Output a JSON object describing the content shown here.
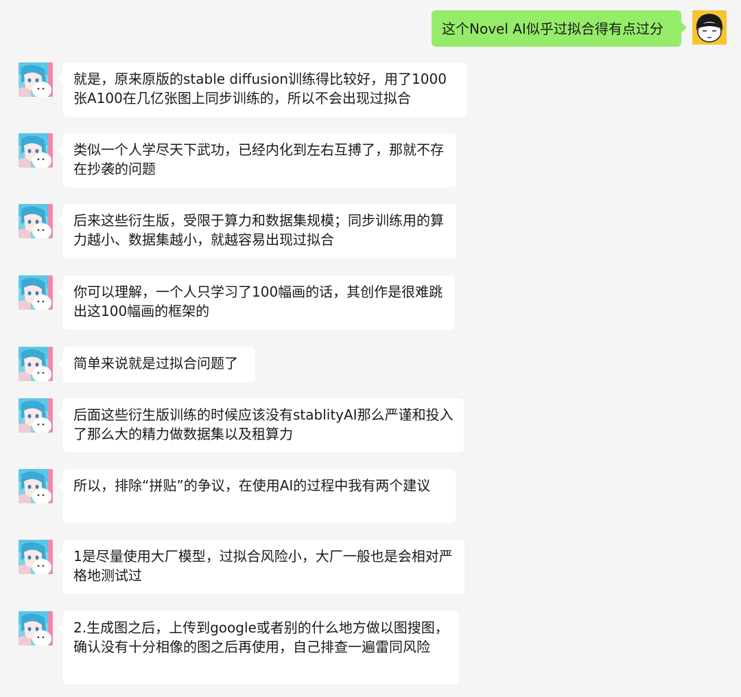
{
  "self_message": {
    "text": "这个Novel AI似乎过拟合得有点过分",
    "avatar": "cartoon-boy-avatar-icon"
  },
  "other_avatar": "anime-girl-avatar-icon",
  "messages": [
    {
      "text": "就是，原来原版的stable diffusion训练得比较好，用了1000张A100在几亿张图上同步训练的，所以不会出现过拟合"
    },
    {
      "text": "类似一个人学尽天下武功，已经内化到左右互搏了，那就不存在抄袭的问题"
    },
    {
      "text": "后来这些衍生版，受限于算力和数据集规模；同步训练用的算力越小、数据集越小，就越容易出现过拟合"
    },
    {
      "text": "你可以理解，一个人只学习了100幅画的话，其创作是很难跳出这100幅画的框架的"
    },
    {
      "text": "简单来说就是过拟合问题了"
    },
    {
      "text": "后面这些衍生版训练的时候应该没有stablityAI那么严谨和投入了那么大的精力做数据集以及租算力"
    },
    {
      "text": "所以，排除“拼贴”的争议，在使用AI的过程中我有两个建议"
    },
    {
      "text": "1是尽量使用大厂模型，过拟合风险小，大厂一般也是会相对严格地测试过"
    },
    {
      "text": "2.生成图之后，上传到google或者别的什么地方做以图搜图，确认没有十分相像的图之后再使用，自己排查一遍雷同风险"
    }
  ],
  "colors": {
    "background": "#f5f5f5",
    "self_bubble": "#95ec69",
    "other_bubble": "#ffffff"
  }
}
